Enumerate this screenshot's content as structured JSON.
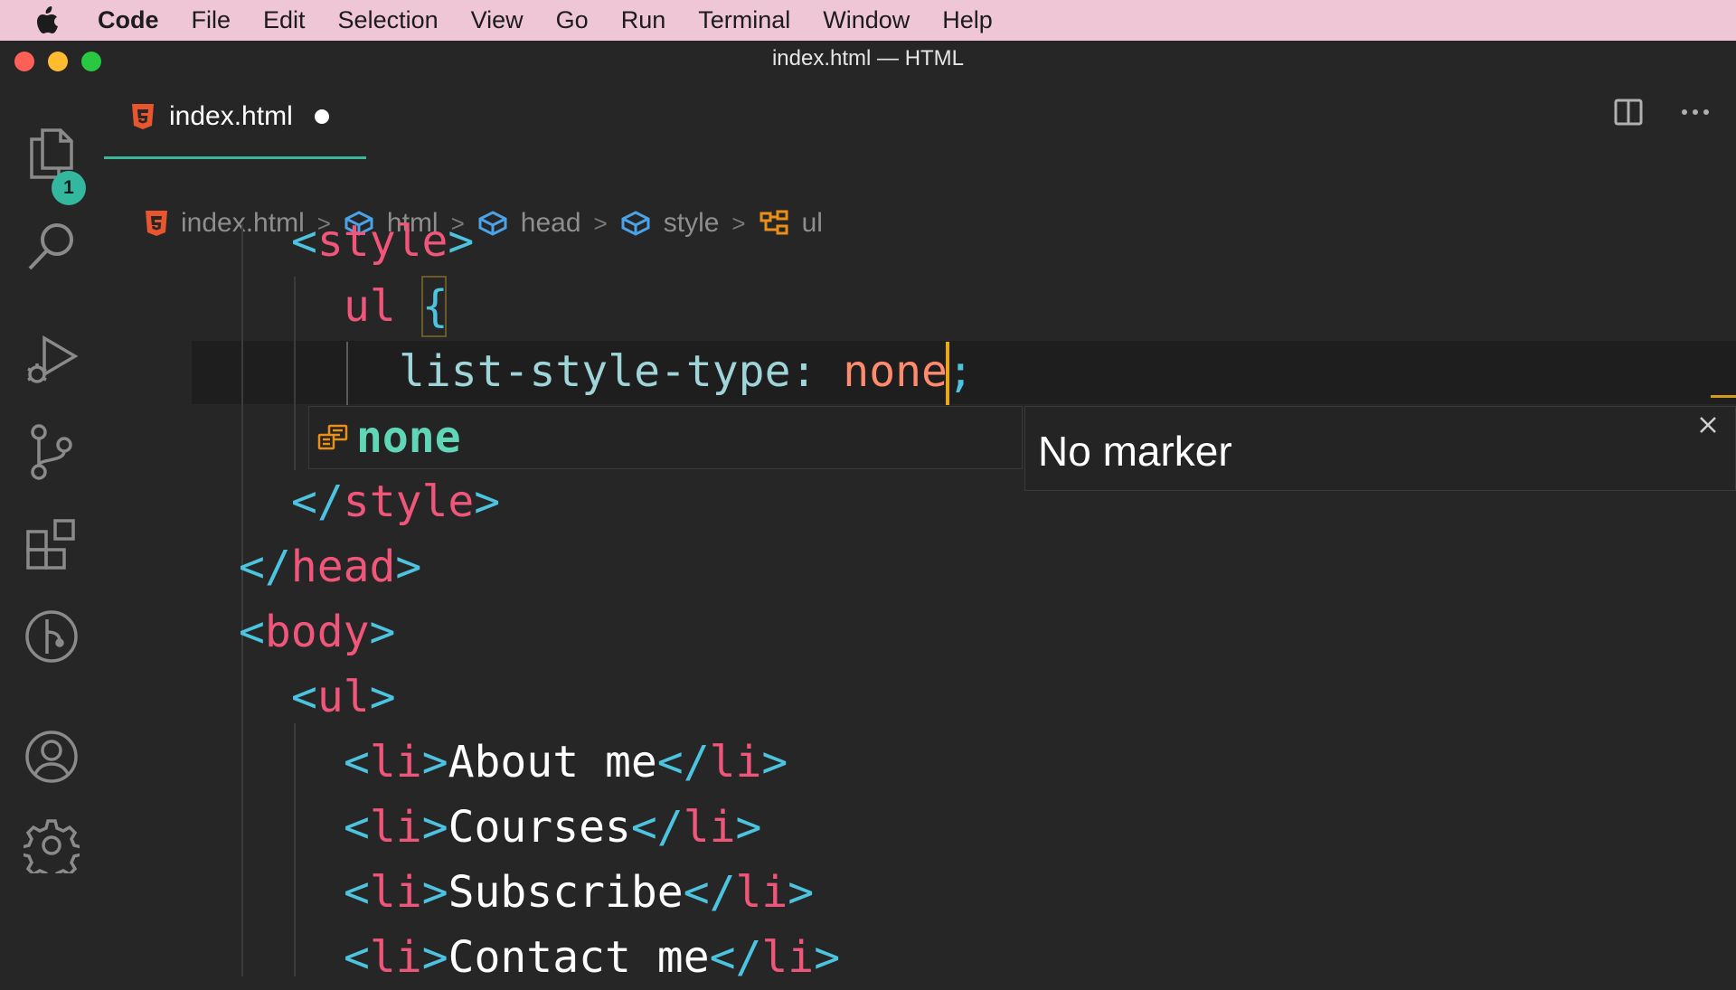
{
  "menubar": {
    "app_name": "Code",
    "items": [
      "File",
      "Edit",
      "Selection",
      "View",
      "Go",
      "Run",
      "Terminal",
      "Window",
      "Help"
    ]
  },
  "window": {
    "title": "index.html — HTML"
  },
  "activity_bar": {
    "explorer_badge": "1"
  },
  "tab": {
    "label": "index.html"
  },
  "breadcrumb": {
    "file": "index.html",
    "items": [
      "html",
      "head",
      "style",
      "ul"
    ]
  },
  "code": {
    "style_open": {
      "open": "<",
      "name": "style",
      "close": ">"
    },
    "selector": {
      "name": "ul",
      "brace": "{"
    },
    "declaration": {
      "property": "list-style-type",
      "colon": ":",
      "value": "none",
      "semicolon": ";"
    },
    "style_close": {
      "open": "</",
      "name": "style",
      "close": ">"
    },
    "head_close": {
      "open": "</",
      "name": "head",
      "close": ">"
    },
    "body_open": {
      "open": "<",
      "name": "body",
      "close": ">"
    },
    "ul_open": {
      "open": "<",
      "name": "ul",
      "close": ">"
    },
    "list_items": [
      {
        "open": "<",
        "tag": "li",
        "gt": ">",
        "text": "About me",
        "close_open": "</",
        "close_tag": "li",
        "close_gt": ">"
      },
      {
        "open": "<",
        "tag": "li",
        "gt": ">",
        "text": "Courses",
        "close_open": "</",
        "close_tag": "li",
        "close_gt": ">"
      },
      {
        "open": "<",
        "tag": "li",
        "gt": ">",
        "text": "Subscribe",
        "close_open": "</",
        "close_tag": "li",
        "close_gt": ">"
      },
      {
        "open": "<",
        "tag": "li",
        "gt": ">",
        "text": "Contact me",
        "close_open": "</",
        "close_tag": "li",
        "close_gt": ">"
      }
    ]
  },
  "suggestion": {
    "label": "none",
    "detail": "No marker"
  },
  "colors": {
    "menubar_bg": "#efc6d6",
    "editor_bg": "#262626",
    "tag_bracket": "#4cc3df",
    "tag_name": "#f0567a",
    "property": "#9fd4d8",
    "value": "#ff8a6e",
    "accent": "#3bb89a",
    "cursor": "#e8a81a"
  }
}
